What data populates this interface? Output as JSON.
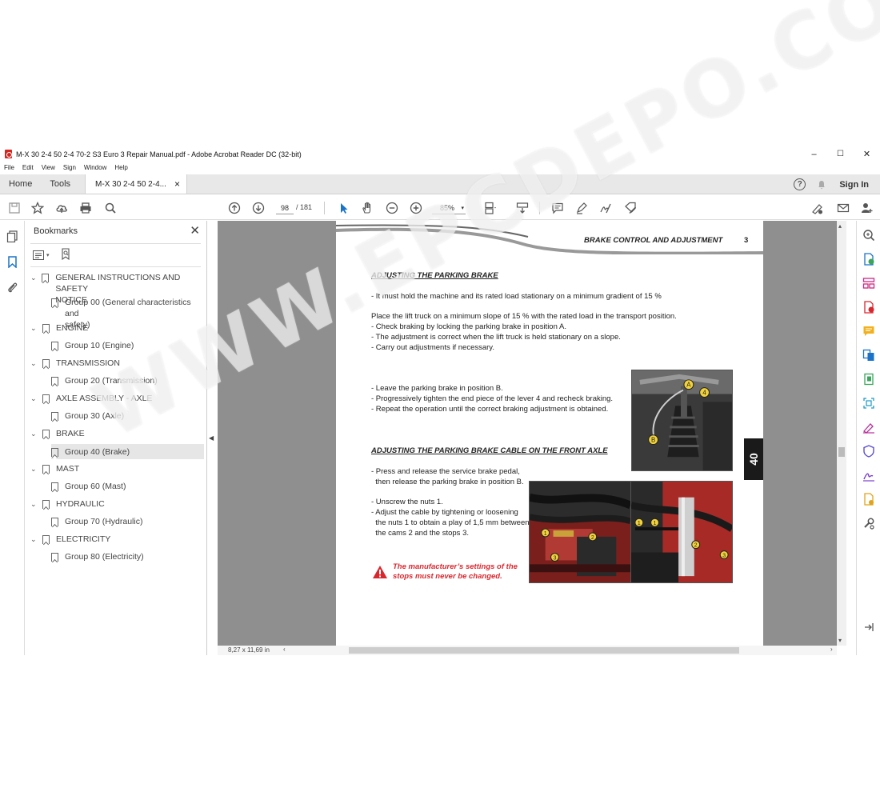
{
  "window": {
    "title": "M-X 30 2-4 50 2-4 70-2 S3 Euro 3 Repair Manual.pdf - Adobe Acrobat Reader DC (32-bit)",
    "minimize": "–",
    "maximize": "☐",
    "close": "✕"
  },
  "menu": [
    "File",
    "Edit",
    "View",
    "Sign",
    "Window",
    "Help"
  ],
  "tabs": {
    "home": "Home",
    "tools": "Tools",
    "doc": "M-X 30 2-4 50 2-4...",
    "doc_close": "×",
    "help": "?",
    "signin": "Sign In"
  },
  "toolbar": {
    "page_current": "98",
    "page_total": "/  181",
    "zoom": "85%"
  },
  "bookmarks": {
    "header": "Bookmarks",
    "close": "✕",
    "items": [
      {
        "label": "GENERAL INSTRUCTIONS AND SAFETY",
        "label2": "NOTICE",
        "level": 0
      },
      {
        "label": "Group 00 (General characteristics and",
        "label2": "safety)",
        "level": 1
      },
      {
        "label": "ENGINE",
        "level": 0
      },
      {
        "label": "Group 10 (Engine)",
        "level": 1
      },
      {
        "label": "TRANSMISSION",
        "level": 0
      },
      {
        "label": "Group 20 (Transmission)",
        "level": 1
      },
      {
        "label": "AXLE ASSEMBLY - AXLE",
        "level": 0
      },
      {
        "label": "Group 30 (Axle)",
        "level": 1
      },
      {
        "label": "BRAKE",
        "level": 0
      },
      {
        "label": "Group 40 (Brake)",
        "level": 1,
        "selected": true
      },
      {
        "label": "MAST",
        "level": 0
      },
      {
        "label": "Group 60 (Mast)",
        "level": 1
      },
      {
        "label": "HYDRAULIC",
        "level": 0
      },
      {
        "label": "Group 70 (Hydraulic)",
        "level": 1
      },
      {
        "label": "ELECTRICITY",
        "level": 0
      },
      {
        "label": "Group 80 (Electricity)",
        "level": 1
      }
    ]
  },
  "page": {
    "header": "BRAKE CONTROL AND ADJUSTMENT",
    "number": "3",
    "section_tab": "40",
    "title1": "ADJUSTING THE PARKING BRAKE",
    "p1": "- It must hold the machine and its rated load stationary on a minimum gradient of 15 %",
    "p2": [
      "Place the lift truck on a minimum slope of 15 % with the rated load in the transport position.",
      "- Check braking by locking the parking brake in position A.",
      "- The adjustment is correct when the lift truck is held stationary on a slope.",
      "- Carry out adjustments if necessary."
    ],
    "p3": [
      "- Leave the parking brake in position B.",
      "- Progressively tighten the end piece of the lever 4 and recheck braking.",
      "- Repeat the operation until the correct braking adjustment is obtained."
    ],
    "title2": "ADJUSTING THE PARKING BRAKE CABLE ON THE FRONT AXLE",
    "p4": [
      "- Press and release the service brake pedal,",
      "  then release the parking brake in position B."
    ],
    "p5": [
      "- Unscrew the nuts 1.",
      "- Adjust the cable by tightening or loosening",
      "  the nuts 1 to obtain a play of 1,5 mm between",
      "  the cams 2 and the stops 3."
    ],
    "warning": [
      "The manufacturer’s settings of the",
      "stops must never be changed."
    ],
    "callouts": {
      "a": "A",
      "b": "B",
      "four": "4",
      "one": "1",
      "two": "2",
      "three": "3"
    }
  },
  "status": {
    "dims": "8,27 x 11,69 in"
  },
  "watermark": "WWW.EPCDEPO.COM",
  "colors": {
    "accent_red": "#d9272e",
    "viewer_bg": "#8f8f8f",
    "callout_yellow": "#f2d23a"
  }
}
